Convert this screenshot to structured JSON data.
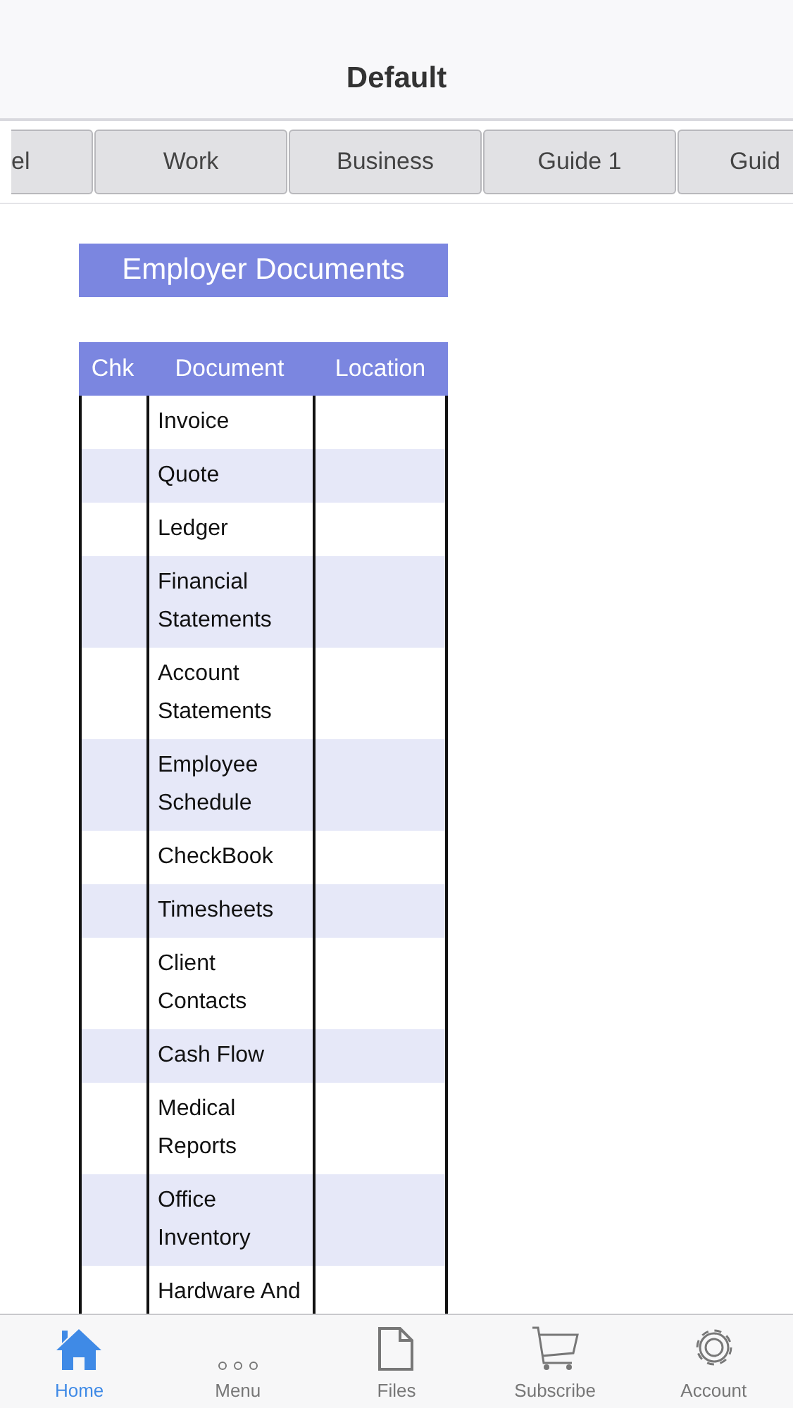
{
  "window": {
    "title": "Default"
  },
  "tabs": [
    {
      "label": "el"
    },
    {
      "label": "Work"
    },
    {
      "label": "Business"
    },
    {
      "label": "Guide 1"
    },
    {
      "label": "Guid"
    }
  ],
  "section": {
    "title": "Employer Documents"
  },
  "table": {
    "columns": [
      "Chk",
      "Document",
      "Location"
    ],
    "rows": [
      {
        "document": "Invoice"
      },
      {
        "document": "Quote"
      },
      {
        "document": "Ledger"
      },
      {
        "document": "Financial Statements"
      },
      {
        "document": "Account Statements"
      },
      {
        "document": "Employee Schedule"
      },
      {
        "document": "CheckBook"
      },
      {
        "document": "Timesheets"
      },
      {
        "document": "Client Contacts"
      },
      {
        "document": "Cash Flow"
      },
      {
        "document": "Medical Reports"
      },
      {
        "document": "Office Inventory"
      },
      {
        "document": "Hardware And"
      }
    ]
  },
  "tab_bar": [
    {
      "label": "Home",
      "kind": "home",
      "selected": true
    },
    {
      "label": "Menu",
      "kind": "more",
      "selected": false
    },
    {
      "label": "Files",
      "kind": "files",
      "selected": false
    },
    {
      "label": "Subscribe",
      "kind": "store",
      "selected": false
    },
    {
      "label": "Account",
      "kind": "account",
      "selected": false
    }
  ]
}
